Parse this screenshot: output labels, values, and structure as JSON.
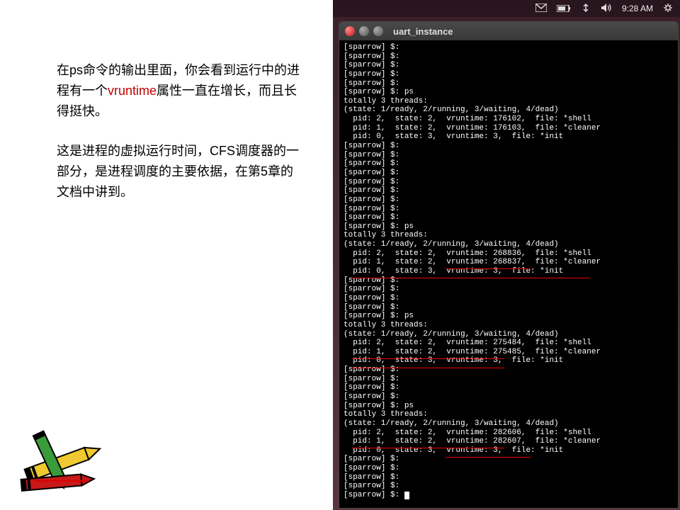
{
  "left_text": {
    "para1_pre": "在ps命令的输出里面，你会看到运行中的进程有一个",
    "para1_red": "vruntime",
    "para1_post": "属性一直在增长，而且长得挺快。",
    "para2": "这是进程的虚拟运行时间，CFS调度器的一部分，是进程调度的主要依据，在第5章的文档中讲到。"
  },
  "menubar": {
    "time": "9:28 AM",
    "mail_icon": "mail-icon",
    "battery_icon": "battery-icon",
    "network_icon": "network-icon",
    "sound_icon": "sound-icon",
    "gear_icon": "gear-icon"
  },
  "window": {
    "title": "uart_instance"
  },
  "terminal": {
    "lines": [
      "[sparrow] $:",
      "[sparrow] $:",
      "[sparrow] $:",
      "[sparrow] $:",
      "[sparrow] $:",
      "[sparrow] $: ps",
      "totally 3 threads:",
      "(state: 1/ready, 2/running, 3/waiting, 4/dead)",
      "  pid: 2,  state: 2,  vruntime: 176102,  file: *shell",
      "  pid: 1,  state: 2,  vruntime: 176103,  file: *cleaner",
      "  pid: 0,  state: 3,  vruntime: 3,  file: *init",
      "[sparrow] $:",
      "[sparrow] $:",
      "[sparrow] $:",
      "[sparrow] $:",
      "[sparrow] $:",
      "[sparrow] $:",
      "[sparrow] $:",
      "[sparrow] $:",
      "[sparrow] $:",
      "[sparrow] $: ps",
      "totally 3 threads:",
      "(state: 1/ready, 2/running, 3/waiting, 4/dead)",
      "  pid: 2,  state: 2,  vruntime: 268836,  file: *shell",
      "  pid: 1,  state: 2,  vruntime: 268837,  file: *cleaner",
      "  pid: 0,  state: 3,  vruntime: 3,  file: *init",
      "[sparrow] $:",
      "[sparrow] $:",
      "[sparrow] $:",
      "[sparrow] $:",
      "[sparrow] $: ps",
      "totally 3 threads:",
      "(state: 1/ready, 2/running, 3/waiting, 4/dead)",
      "  pid: 2,  state: 2,  vruntime: 275484,  file: *shell",
      "  pid: 1,  state: 2,  vruntime: 275485,  file: *cleaner",
      "  pid: 0,  state: 3,  vruntime: 3,  file: *init",
      "[sparrow] $:",
      "[sparrow] $:",
      "[sparrow] $:",
      "[sparrow] $:",
      "[sparrow] $: ps",
      "totally 3 threads:",
      "(state: 1/ready, 2/running, 3/waiting, 4/dead)",
      "  pid: 2,  state: 2,  vruntime: 282606,  file: *shell",
      "  pid: 1,  state: 2,  vruntime: 282607,  file: *cleaner",
      "  pid: 0,  state: 3,  vruntime: 3,  file: *init",
      "[sparrow] $:",
      "[sparrow] $:",
      "[sparrow] $:",
      "[sparrow] $:",
      "[sparrow] $: "
    ]
  }
}
